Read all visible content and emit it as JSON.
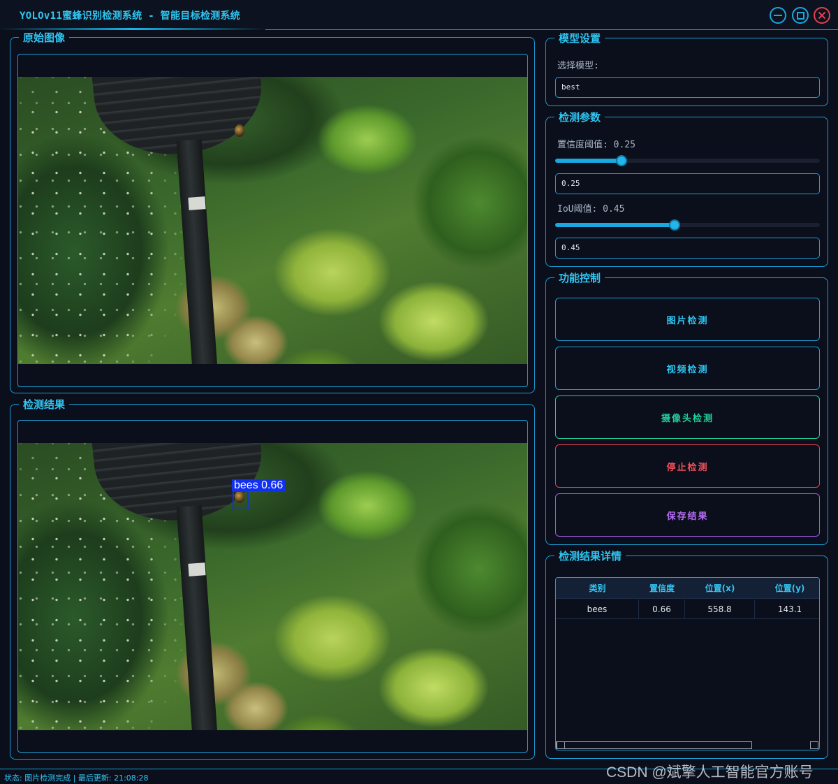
{
  "window": {
    "title": "YOLOv11蜜蜂识别检测系统 - 智能目标检测系统"
  },
  "original_panel": {
    "title": "原始图像"
  },
  "result_panel": {
    "title": "检测结果",
    "detection_label": "bees 0.66"
  },
  "model_settings": {
    "title": "模型设置",
    "select_label": "选择模型:",
    "selected_model": "best"
  },
  "detection_params": {
    "title": "检测参数",
    "confidence_label": "置信度阈值: 0.25",
    "confidence_value": "0.25",
    "confidence_fraction": 0.25,
    "iou_label": "IoU阈值: 0.45",
    "iou_value": "0.45",
    "iou_fraction": 0.45
  },
  "controls": {
    "title": "功能控制",
    "image_detect": "图片检测",
    "video_detect": "视频检测",
    "camera_detect": "摄像头检测",
    "stop_detect": "停止检测",
    "save_result": "保存结果"
  },
  "results_table": {
    "title": "检测结果详情",
    "headers": [
      "类别",
      "置信度",
      "位置(x)",
      "位置(y)"
    ],
    "rows": [
      [
        "bees",
        "0.66",
        "558.8",
        "143.1"
      ]
    ]
  },
  "status": {
    "text": "状态: 图片检测完成 | 最后更新: 21:08:28"
  },
  "watermark": "CSDN @斌擎人工智能官方账号",
  "colors": {
    "accent": "#1a9fd4",
    "title_text": "#2fc6f2",
    "image_button": "#1a9fd4",
    "video_button": "#1a9fd4",
    "camera_button": "#1fd09a",
    "stop_button": "#e3414f",
    "save_button": "#a05ae8",
    "bbox": "#1230f0"
  }
}
